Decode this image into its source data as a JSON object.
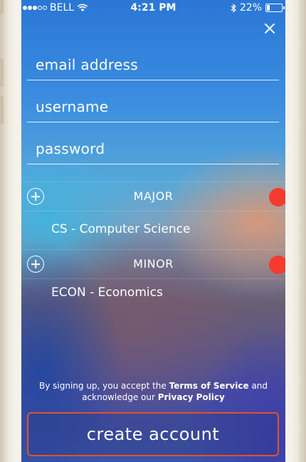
{
  "status_bar": {
    "carrier": "BELL",
    "time": "4:21 PM",
    "battery_percent": "22%",
    "battery_level": 0.22
  },
  "icons": {
    "close": "close-icon",
    "wifi": "wifi-icon",
    "bluetooth": "bluetooth-icon",
    "battery": "battery-icon",
    "add": "plus-circle-icon"
  },
  "form": {
    "email_placeholder": "email address",
    "username_placeholder": "username",
    "password_placeholder": "password"
  },
  "major": {
    "title": "MAJOR",
    "item": "CS - Computer Science"
  },
  "minor": {
    "title": "MINOR",
    "item": "ECON - Economics"
  },
  "terms": {
    "prefix": "By signing up, you accept the ",
    "tos_link": "Terms of Service",
    "middle": " and acknowledge our ",
    "privacy_link": "Privacy Policy"
  },
  "create_button": "create account",
  "colors": {
    "accent_red": "#f53b30",
    "button_border": "#e0522b"
  }
}
